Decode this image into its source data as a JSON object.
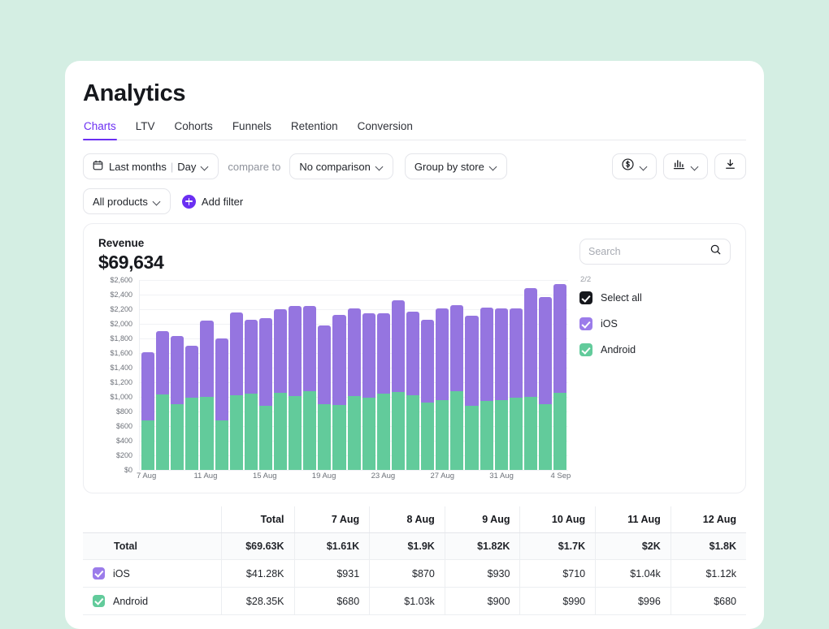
{
  "header": {
    "title": "Analytics"
  },
  "tabs": [
    {
      "label": "Charts",
      "active": true
    },
    {
      "label": "LTV",
      "active": false
    },
    {
      "label": "Cohorts",
      "active": false
    },
    {
      "label": "Funnels",
      "active": false
    },
    {
      "label": "Retention",
      "active": false
    },
    {
      "label": "Conversion",
      "active": false
    }
  ],
  "toolbar": {
    "date_range": "Last months",
    "date_sep": "|",
    "granularity": "Day",
    "compare_to_label": "compare to",
    "comparison": "No comparison",
    "group_by": "Group by store",
    "products": "All products",
    "add_filter": "Add filter",
    "currency_icon": "dollar-circle-icon",
    "chart_type_icon": "bar-chart-icon",
    "download_icon": "download-icon",
    "calendar_icon": "calendar-icon"
  },
  "chart_card": {
    "metric_label": "Revenue",
    "metric_value": "$69,634",
    "search_placeholder": "Search",
    "search_value": "",
    "search_icon": "search-icon",
    "selected_count": "2/2",
    "legend": [
      {
        "label": "Select all",
        "color": "#16181d",
        "checked": true
      },
      {
        "label": "iOS",
        "color": "#9b7cea",
        "checked": true
      },
      {
        "label": "Android",
        "color": "#62cb9b",
        "checked": true
      }
    ]
  },
  "chart_data": {
    "type": "bar",
    "stacked": true,
    "title": "Revenue",
    "xlabel": "",
    "ylabel": "",
    "ylim": [
      0,
      2600
    ],
    "grid": true,
    "legend_position": "right",
    "ytick_labels": [
      "$0",
      "$200",
      "$400",
      "$600",
      "$800",
      "$1,000",
      "$1,200",
      "$1,400",
      "$1,600",
      "$1,800",
      "$2,000",
      "$2,200",
      "$2,400",
      "$2,600"
    ],
    "xtick_labels": [
      "7 Aug",
      "11 Aug",
      "15 Aug",
      "19 Aug",
      "23 Aug",
      "27 Aug",
      "31 Aug",
      "4 Sep"
    ],
    "categories": [
      "7 Aug",
      "8 Aug",
      "9 Aug",
      "10 Aug",
      "11 Aug",
      "12 Aug",
      "13 Aug",
      "14 Aug",
      "15 Aug",
      "16 Aug",
      "17 Aug",
      "18 Aug",
      "19 Aug",
      "20 Aug",
      "21 Aug",
      "22 Aug",
      "23 Aug",
      "24 Aug",
      "25 Aug",
      "26 Aug",
      "27 Aug",
      "28 Aug",
      "29 Aug",
      "30 Aug",
      "31 Aug",
      "1 Sep",
      "2 Sep",
      "3 Sep",
      "4 Sep"
    ],
    "series": [
      {
        "name": "Android",
        "color": "#62cb9b",
        "values": [
          680,
          1030,
          900,
          990,
          996,
          680,
          1020,
          1040,
          880,
          1060,
          1010,
          1080,
          900,
          890,
          1010,
          990,
          1040,
          1070,
          1020,
          920,
          960,
          1080,
          880,
          940,
          960,
          990,
          1000,
          900,
          1060
        ]
      },
      {
        "name": "iOS",
        "color": "#9575e0",
        "values": [
          931,
          870,
          930,
          710,
          1044,
          1120,
          1140,
          1020,
          1200,
          1140,
          1230,
          1160,
          1080,
          1230,
          1200,
          1150,
          1100,
          1250,
          1150,
          1140,
          1250,
          1180,
          1230,
          1280,
          1250,
          1220,
          1490,
          1470,
          1490
        ]
      }
    ],
    "totals": [
      1611,
      1900,
      1830,
      1700,
      2040,
      1800,
      2160,
      2060,
      2080,
      2200,
      2240,
      2240,
      1980,
      2120,
      2210,
      2140,
      2140,
      2320,
      2170,
      2060,
      2210,
      2260,
      2110,
      2220,
      2210,
      2210,
      2490,
      2370,
      2550
    ]
  },
  "table": {
    "columns": [
      "",
      "Total",
      "7 Aug",
      "8 Aug",
      "9 Aug",
      "10 Aug",
      "11 Aug",
      "12 Aug"
    ],
    "rows": [
      {
        "label": "Total",
        "checkbox": null,
        "is_total": true,
        "values": [
          "$69.63K",
          "$1.61K",
          "$1.9K",
          "$1.82K",
          "$1.7K",
          "$2K",
          "$1.8K"
        ]
      },
      {
        "label": "iOS",
        "checkbox": "#9b7cea",
        "is_total": false,
        "values": [
          "$41.28K",
          "$931",
          "$870",
          "$930",
          "$710",
          "$1.04k",
          "$1.12k"
        ]
      },
      {
        "label": "Android",
        "checkbox": "#62cb9b",
        "is_total": false,
        "values": [
          "$28.35K",
          "$680",
          "$1.03k",
          "$900",
          "$990",
          "$996",
          "$680"
        ]
      }
    ]
  },
  "colors": {
    "page_background": "#d4eee3",
    "accent": "#6b2ff2",
    "ios": "#9575e0",
    "android": "#62cb9b"
  }
}
